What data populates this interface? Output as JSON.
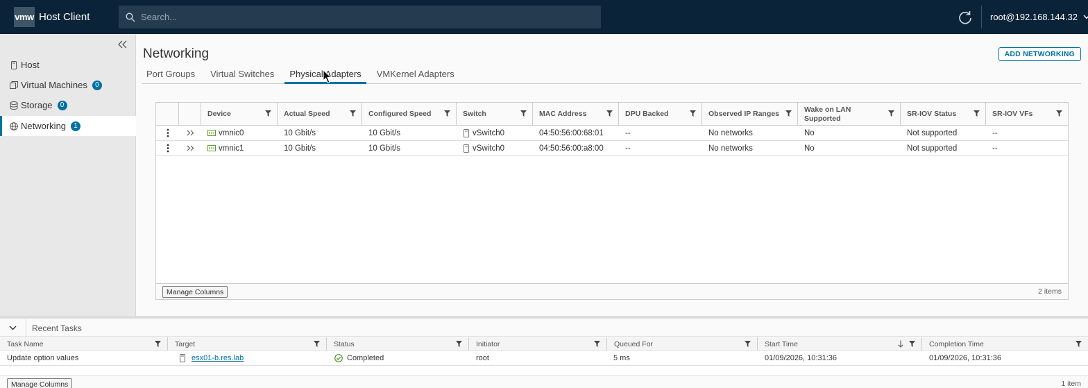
{
  "header": {
    "logo_text": "vmw",
    "app_title": "Host Client",
    "search_placeholder": "Search...",
    "user": "root@192.168.144.32"
  },
  "sidebar": {
    "items": [
      {
        "label": "Host",
        "icon": "host-icon"
      },
      {
        "label": "Virtual Machines",
        "badge": "0",
        "icon": "vm-icon"
      },
      {
        "label": "Storage",
        "badge": "0",
        "icon": "storage-icon"
      },
      {
        "label": "Networking",
        "badge": "1",
        "icon": "network-icon",
        "active": true
      }
    ]
  },
  "main": {
    "title": "Networking",
    "add_button": "ADD NETWORKING",
    "tabs": [
      "Port Groups",
      "Virtual Switches",
      "Physical Adapters",
      "VMKernel Adapters"
    ],
    "active_tab": "Physical Adapters",
    "grid": {
      "columns": [
        "Device",
        "Actual Speed",
        "Configured Speed",
        "Switch",
        "MAC Address",
        "DPU Backed",
        "Observed IP Ranges",
        "Wake on LAN Supported",
        "SR-IOV Status",
        "SR-IOV VFs"
      ],
      "rows": [
        {
          "device": "vmnic0",
          "actual_speed": "10 Gbit/s",
          "configured_speed": "10 Gbit/s",
          "switch": "vSwitch0",
          "mac": "04:50:56:00:68:01",
          "dpu": "--",
          "ip_ranges": "No networks",
          "wol": "No",
          "sriov_status": "Not supported",
          "sriov_vfs": "--"
        },
        {
          "device": "vmnic1",
          "actual_speed": "10 Gbit/s",
          "configured_speed": "10 Gbit/s",
          "switch": "vSwitch0",
          "mac": "04:50:56:00:a8:00",
          "dpu": "--",
          "ip_ranges": "No networks",
          "wol": "No",
          "sriov_status": "Not supported",
          "sriov_vfs": "--"
        }
      ],
      "manage_columns": "Manage Columns",
      "count": "2 items"
    }
  },
  "tasks": {
    "title": "Recent Tasks",
    "columns": [
      "Task Name",
      "Target",
      "Status",
      "Initiator",
      "Queued For",
      "Start Time",
      "Completion Time"
    ],
    "rows": [
      {
        "task": "Update option values",
        "target": "esx01-b.res.lab",
        "status": "Completed",
        "initiator": "root",
        "queued": "5 ms",
        "start": "01/09/2026, 10:31:36",
        "completion": "01/09/2026, 10:31:36"
      }
    ],
    "manage_columns": "Manage Columns",
    "count": "1 item"
  },
  "colors": {
    "header_bg": "#0b2338",
    "accent": "#0072a3",
    "status_ok": "#2f8400"
  }
}
